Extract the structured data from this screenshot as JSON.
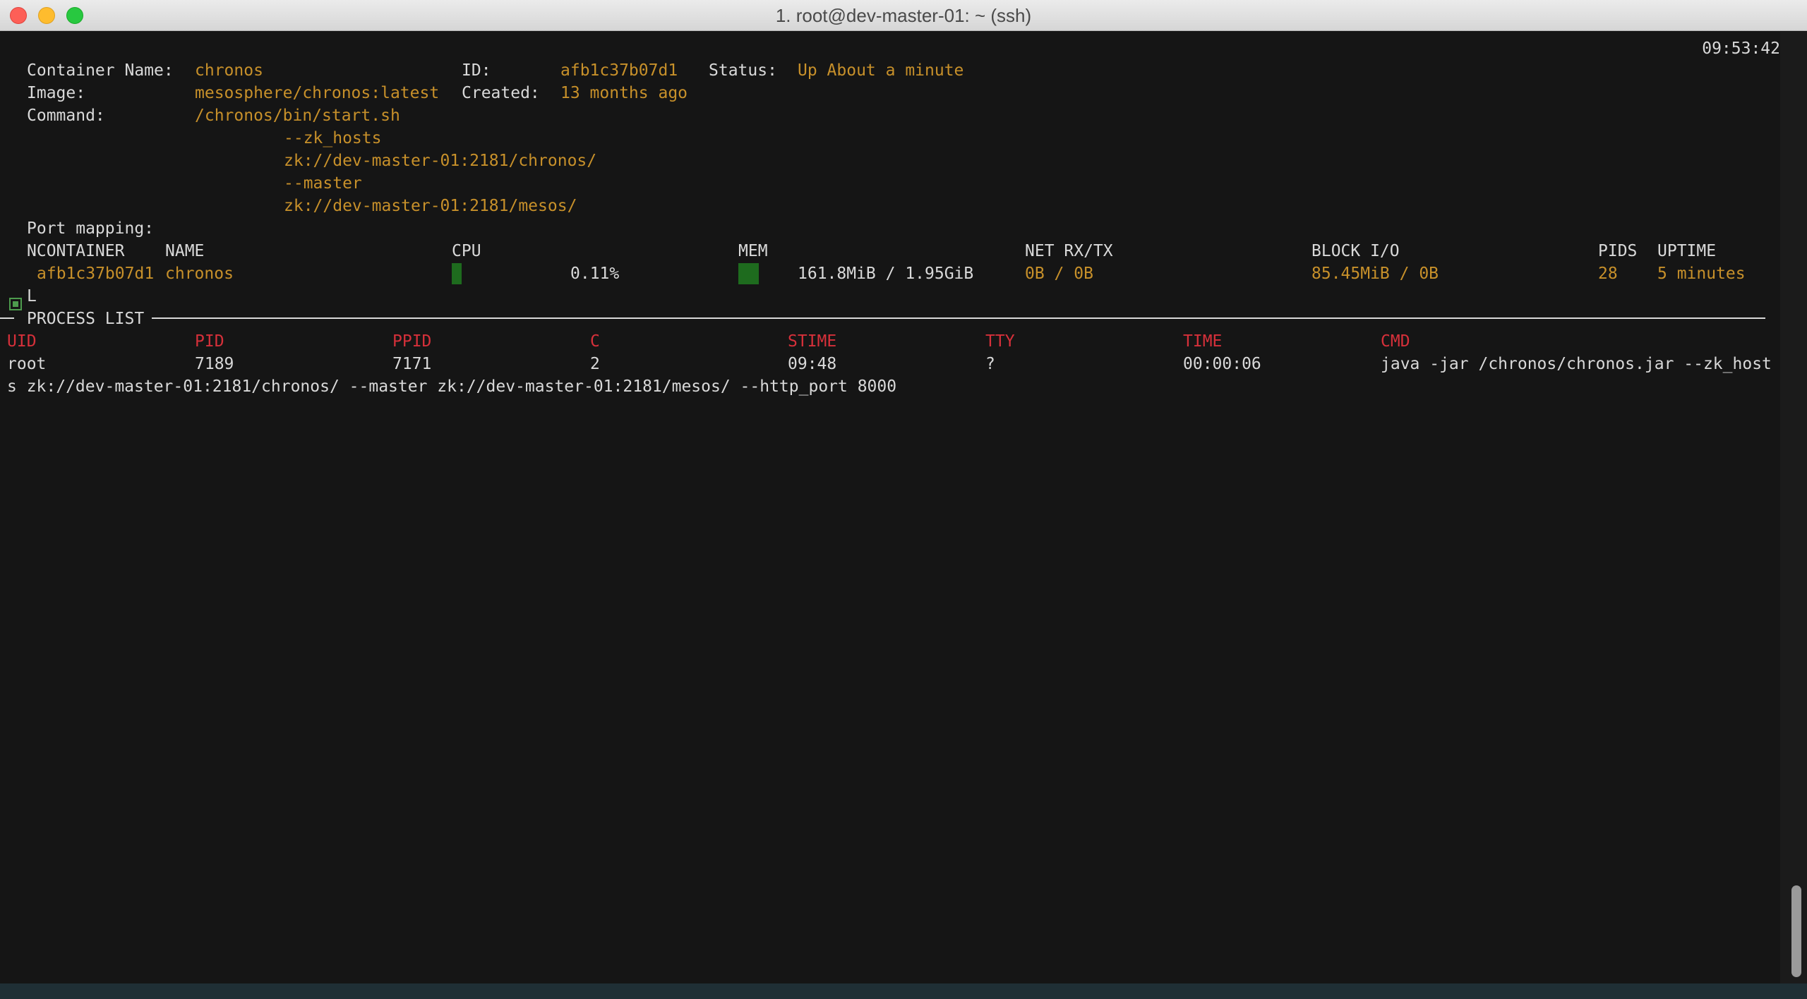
{
  "window": {
    "title": "1. root@dev-master-01: ~ (ssh)"
  },
  "clock": "09:53:42",
  "container": {
    "name_label": "Container Name:",
    "name": "chronos",
    "id_label": "ID:",
    "id": "afb1c37b07d1",
    "status_label": "Status:",
    "status": "Up About a minute",
    "image_label": "Image:",
    "image": "mesosphere/chronos:latest",
    "created_label": "Created:",
    "created": "13 months ago",
    "command_label": "Command:",
    "command_lines": [
      "/chronos/bin/start.sh",
      "--zk_hosts",
      "zk://dev-master-01:2181/chronos/",
      "--master",
      "zk://dev-master-01:2181/mesos/"
    ],
    "port_mapping_label": "Port mapping:"
  },
  "stats": {
    "headers": {
      "container": "NCONTAINER",
      "name": "NAME",
      "cpu": "CPU",
      "mem": "MEM",
      "net": "NET RX/TX",
      "block": "BLOCK I/O",
      "pids": "PIDS",
      "uptime": "UPTIME"
    },
    "row": {
      "container": "afb1c37b07d1",
      "name": "chronos",
      "cpu": "0.11%",
      "cpu_fraction": 0.0011,
      "mem": "161.8MiB / 1.95GiB",
      "mem_fraction": 0.081,
      "net": "0B / 0B",
      "block": "85.45MiB / 0B",
      "pids": "28",
      "uptime": "5 minutes"
    },
    "tree_marker": "L"
  },
  "process_list": {
    "title": "PROCESS LIST",
    "headers": [
      "UID",
      "PID",
      "PPID",
      "C",
      "STIME",
      "TTY",
      "TIME",
      "CMD"
    ],
    "row": [
      "root",
      "7189",
      "7171",
      "2",
      "09:48",
      "?",
      "00:00:06",
      "java -jar /chronos/chronos.jar --zk_host"
    ],
    "cmd_wrap": "s zk://dev-master-01:2181/chronos/ --master zk://dev-master-01:2181/mesos/ --http_port 8000"
  },
  "colors": {
    "background": "#151515",
    "foreground": "#d9d9d9",
    "value": "#c7902a",
    "header_red": "#d6303a",
    "bar_green": "#1e6b1e"
  }
}
